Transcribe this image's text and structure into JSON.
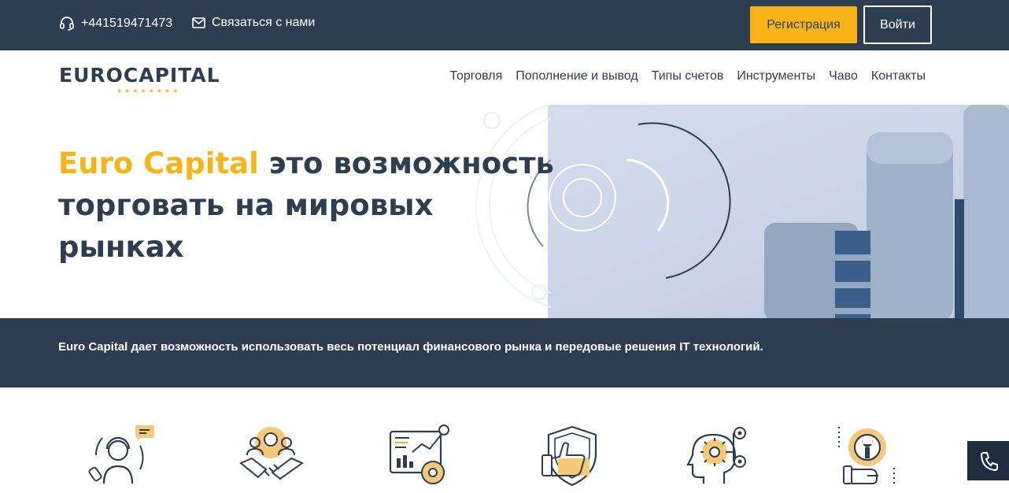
{
  "topbar": {
    "phone": "+441519471473",
    "contact_label": "Связаться с нами",
    "register_label": "Регистрация",
    "login_label": "Войти"
  },
  "logo": {
    "text": "EUROCAPITAL",
    "stars": "★★★★★★★★"
  },
  "nav": {
    "items": [
      {
        "label": "Торговля"
      },
      {
        "label": "Пополнение и вывод"
      },
      {
        "label": "Типы счетов"
      },
      {
        "label": "Инструменты"
      },
      {
        "label": "Чаво"
      },
      {
        "label": "Контакты"
      }
    ]
  },
  "hero": {
    "title_accent": "Euro Capital",
    "title_rest": " это возможность торговать на мировых рынках"
  },
  "band": {
    "text": "Euro Capital дает возможность использовать весь потенциал финансового рынка и передовые решения IT технологий."
  },
  "features": {
    "icons": [
      "support-icon",
      "partnership-icon",
      "analytics-icon",
      "secure-like-icon",
      "intelligence-icon",
      "tools-icon"
    ]
  },
  "colors": {
    "dark": "#2c3e50",
    "accent": "#f8b417",
    "white": "#ffffff"
  }
}
